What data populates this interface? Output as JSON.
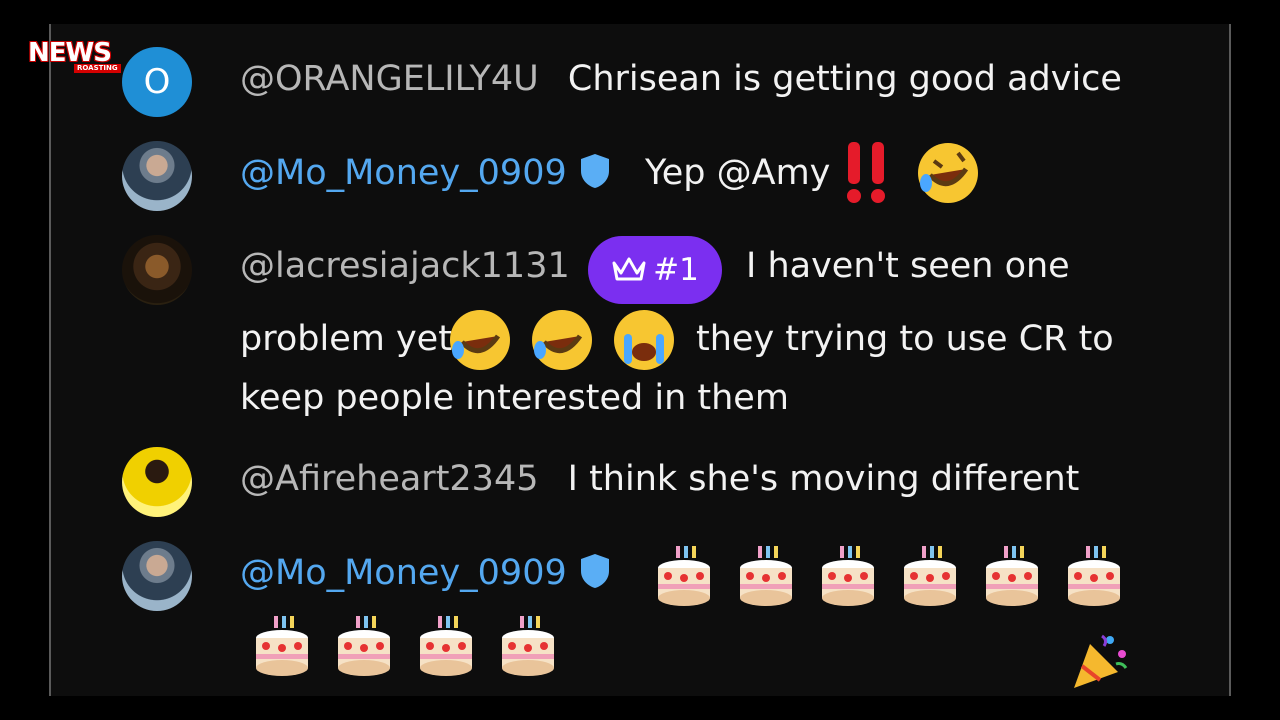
{
  "logo": {
    "word": "NEWS",
    "sub": "ROASTING"
  },
  "comments": [
    {
      "avatar_letter": "O",
      "username": "@ORANGELILY4U",
      "message": "Chrisean is getting good advice"
    },
    {
      "username": "@Mo_Money_0909",
      "message": "Yep @Amy"
    },
    {
      "username": "@lacresiajack1131",
      "badge": "#1",
      "message_line1": "I haven't seen one",
      "message_line2a": "problem yet",
      "message_line2b": "they trying to use CR to",
      "message_line3": "keep people interested in them"
    },
    {
      "username": "@Afireheart2345",
      "message": "I think she's moving different"
    },
    {
      "username": "@Mo_Money_0909"
    }
  ],
  "colors": {
    "accent_blue": "#54a8f0",
    "badge_purple": "#7b2ff0",
    "avatar_blue": "#1f8fd6"
  },
  "icons": [
    "verified-shield-icon",
    "crown-icon",
    "double-exclamation-icon",
    "rofl-emoji-icon",
    "crying-emoji-icon",
    "birthday-cake-icon",
    "party-popper-icon"
  ]
}
